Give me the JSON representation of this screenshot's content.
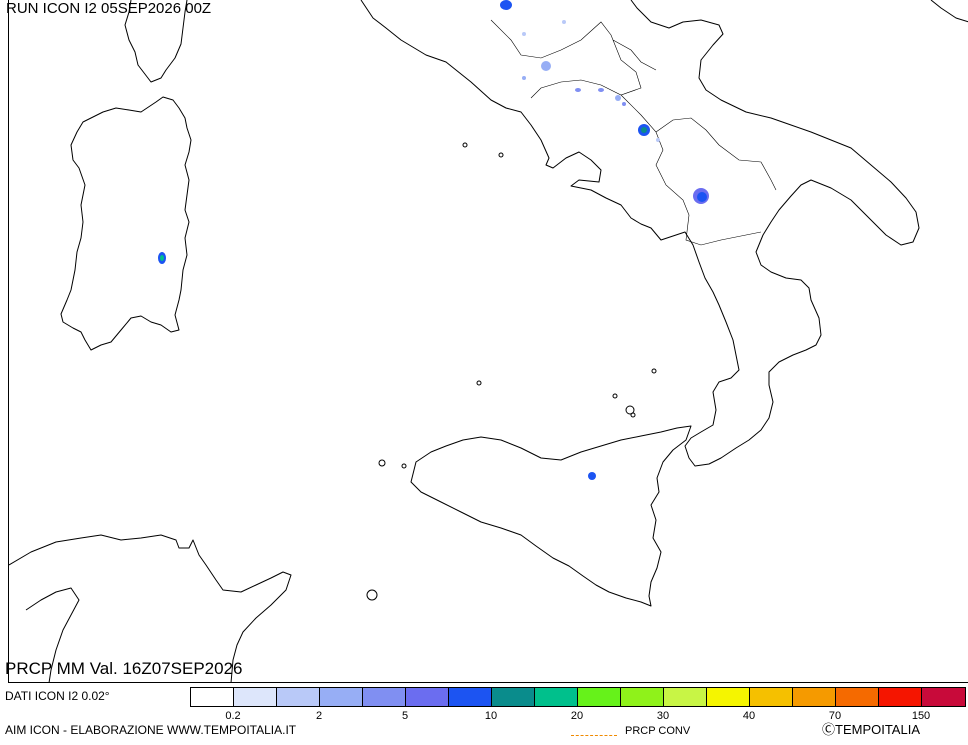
{
  "header": {
    "run_title": "RUN ICON I2 05SEP2026 00Z"
  },
  "product": {
    "title": "PRCP MM Val. 16Z07SEP2026"
  },
  "footer": {
    "dati_label": "DATI ICON I2 0.02°",
    "credit_left": "AIM ICON - ELABORAZIONE WWW.TEMPOITALIA.IT",
    "conv_label": "PRCP CONV",
    "credit_right": "ⒸTEMPOITALIA"
  },
  "legend": {
    "colors": [
      "#ffffff",
      "#dde6fb",
      "#b9c9f8",
      "#97aef5",
      "#808ff2",
      "#6b6df0",
      "#1c54f2",
      "#0a8c8c",
      "#00c08c",
      "#66f21a",
      "#8ff21a",
      "#c8f545",
      "#f5f500",
      "#f5c000",
      "#f59a00",
      "#f56a00",
      "#f51500",
      "#c80a3a"
    ],
    "ticks": [
      "0.2",
      "2",
      "5",
      "10",
      "20",
      "30",
      "40",
      "70",
      "150"
    ]
  },
  "map": {
    "coast_color": "#000000",
    "land_color": "#ffffff",
    "sea_color": "#ffffff"
  }
}
